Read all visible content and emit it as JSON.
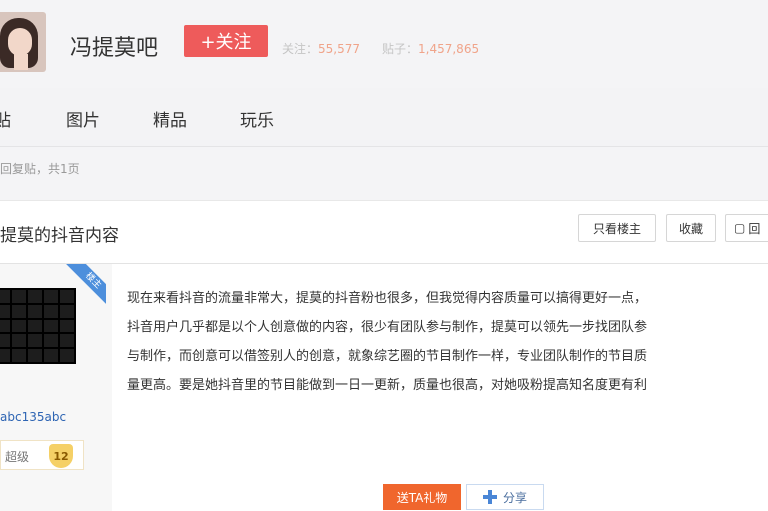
{
  "header": {
    "bar_name": "冯提莫吧",
    "follow_label": "+关注",
    "follow_label_text": "关注",
    "stats": [
      {
        "label": "关注：",
        "value": "55,577"
      },
      {
        "label": "贴子：",
        "value": "1,457,865"
      }
    ]
  },
  "nav": {
    "items": [
      "贴",
      "图片",
      "精品",
      "玩乐"
    ]
  },
  "breadcrumb": "回复贴，共1页",
  "post": {
    "title": "提莫的抖音内容",
    "buttons": {
      "only_op": "只看楼主",
      "favorite": "收藏",
      "reply": "回"
    },
    "badge": "楼主",
    "username": "abc135abc",
    "level_title": "超级",
    "level_num": "12",
    "lines": [
      "现在来看抖音的流量非常大，提莫的抖音粉也很多，但我觉得内容质量可以搞得更好一点，",
      "抖音用户几乎都是以个人创意做的内容，很少有团队参与制作，提莫可以领先一步找团队参",
      "与制作，而创意可以借签别人的创意，就象综艺圈的节目制作一样，专业团队制作的节目质",
      "量更高。要是她抖音里的节目能做到一日一更新，质量也很高，对她吸粉提高知名度更有利"
    ],
    "send_gift": "送TA礼物",
    "share": "分享"
  },
  "colors": {
    "follow": "#ee5b5b",
    "gift": "#f0662d",
    "link": "#2d64b3",
    "badge": "#4d8fdc"
  }
}
